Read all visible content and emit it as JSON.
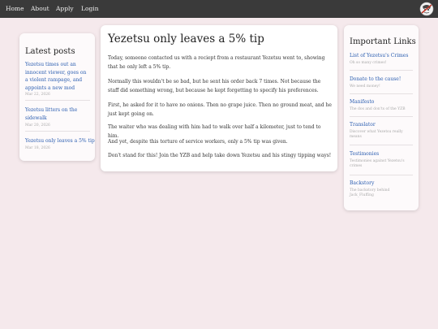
{
  "nav": {
    "items": [
      "Home",
      "About",
      "Apply",
      "Login"
    ]
  },
  "latest_posts": {
    "title": "Latest posts",
    "posts": [
      {
        "title": "Yezetsu times out an innocent viewer, goes on a violent rampage, and appoints a new mod",
        "date": "Mar 22, 2026"
      },
      {
        "title": "Yezetsu litters on the sidewalk",
        "date": "Mar 20, 2026"
      },
      {
        "title": "Yezetsu only leaves a 5% tip",
        "date": "Mar 18, 2026"
      }
    ]
  },
  "article": {
    "title": "Yezetsu only leaves a 5% tip",
    "paragraphs": [
      "Today, someone contacted us with a reciept from a restaurant Yezetsu went to, showing that he only left a 5% tip.",
      "Normally this wouldn't be so bad, but he sent his order back 7 times. Not because the staff did something wrong, but because he kept forgetting to specify his preferences.",
      "First, he asked for it to have no onions. Then no grape juice. Then no ground meat, and he just kept going on.",
      "The waiter who was dealing with him had to walk over half a kilometer, just to tend to him.",
      "And yet, despite this torture of service workers, only a 5% tip was given.",
      "Don't stand for this! Join the YZB and help take down Yezetsu and his stingy tipping ways!"
    ]
  },
  "important_links": {
    "title": "Important Links",
    "links": [
      {
        "title": "List of Yezetsu's Crimes",
        "subtitle": "Oh so many crimes!"
      },
      {
        "title": "Donate to the cause!",
        "subtitle": "We need money!"
      },
      {
        "title": "Manifesto",
        "subtitle": "The dos and don'ts of the YZB"
      },
      {
        "title": "Translator",
        "subtitle": "Discover what Yezetsu really means"
      },
      {
        "title": "Testimonies",
        "subtitle": "Testimonies against Yezetsu's crimes"
      },
      {
        "title": "Backstory",
        "subtitle": "The backstory behind Jack_Fluffing"
      }
    ]
  },
  "colors": {
    "background": "#f5e9ec",
    "topbar": "#3a3a3a",
    "link": "#2a5db0"
  }
}
